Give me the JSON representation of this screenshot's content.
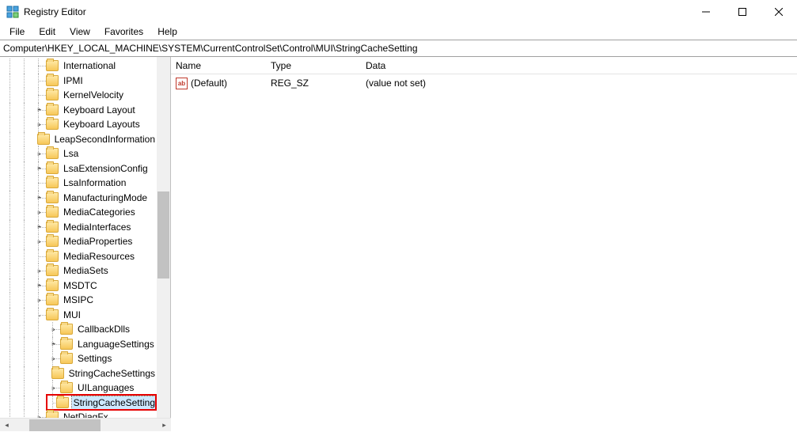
{
  "window": {
    "title": "Registry Editor"
  },
  "menu": {
    "file": "File",
    "edit": "Edit",
    "view": "View",
    "favorites": "Favorites",
    "help": "Help"
  },
  "address": "Computer\\HKEY_LOCAL_MACHINE\\SYSTEM\\CurrentControlSet\\Control\\MUI\\StringCacheSetting",
  "tree": {
    "items": [
      {
        "label": "International",
        "depth": 3,
        "expander": ""
      },
      {
        "label": "IPMI",
        "depth": 3,
        "expander": ""
      },
      {
        "label": "KernelVelocity",
        "depth": 3,
        "expander": ""
      },
      {
        "label": "Keyboard Layout",
        "depth": 3,
        "expander": ">"
      },
      {
        "label": "Keyboard Layouts",
        "depth": 3,
        "expander": ">"
      },
      {
        "label": "LeapSecondInformation",
        "depth": 3,
        "expander": ""
      },
      {
        "label": "Lsa",
        "depth": 3,
        "expander": ">"
      },
      {
        "label": "LsaExtensionConfig",
        "depth": 3,
        "expander": ">"
      },
      {
        "label": "LsaInformation",
        "depth": 3,
        "expander": ""
      },
      {
        "label": "ManufacturingMode",
        "depth": 3,
        "expander": ">"
      },
      {
        "label": "MediaCategories",
        "depth": 3,
        "expander": ">"
      },
      {
        "label": "MediaInterfaces",
        "depth": 3,
        "expander": ">"
      },
      {
        "label": "MediaProperties",
        "depth": 3,
        "expander": ">"
      },
      {
        "label": "MediaResources",
        "depth": 3,
        "expander": ""
      },
      {
        "label": "MediaSets",
        "depth": 3,
        "expander": ">"
      },
      {
        "label": "MSDTC",
        "depth": 3,
        "expander": ">"
      },
      {
        "label": "MSIPC",
        "depth": 3,
        "expander": ">"
      },
      {
        "label": "MUI",
        "depth": 3,
        "expander": "v"
      },
      {
        "label": "CallbackDlls",
        "depth": 4,
        "expander": ">"
      },
      {
        "label": "LanguageSettings",
        "depth": 4,
        "expander": ">"
      },
      {
        "label": "Settings",
        "depth": 4,
        "expander": ">"
      },
      {
        "label": "StringCacheSettings",
        "depth": 4,
        "expander": ""
      },
      {
        "label": "UILanguages",
        "depth": 4,
        "expander": ">"
      },
      {
        "label": "StringCacheSetting",
        "depth": 4,
        "expander": "",
        "selected": true,
        "highlighted": true
      },
      {
        "label": "NetDiagFx",
        "depth": 3,
        "expander": ">"
      }
    ]
  },
  "list": {
    "columns": {
      "name": "Name",
      "type": "Type",
      "data": "Data"
    },
    "rows": [
      {
        "name": "(Default)",
        "type": "REG_SZ",
        "data": "(value not set)"
      }
    ]
  }
}
